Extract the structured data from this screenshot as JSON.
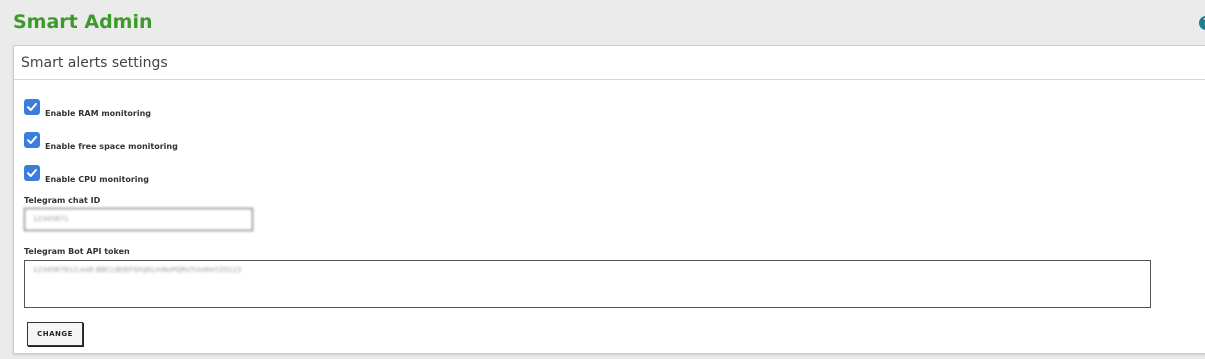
{
  "header": {
    "app_title": "Smart Admin",
    "help_icon": "?"
  },
  "panel": {
    "title": "Smart alerts settings",
    "checkboxes": [
      {
        "label": "Enable RAM monitoring",
        "checked": true
      },
      {
        "label": "Enable free space monitoring",
        "checked": true
      },
      {
        "label": "Enable CPU monitoring",
        "checked": true
      }
    ],
    "chat_id": {
      "label": "Telegram chat ID",
      "value": "12345671"
    },
    "bot_token": {
      "label": "Telegram Bot API token",
      "value": "1234567812:AAE-BBCcdDEFGhiJKLmNoPQRsTUvWxYZ0123"
    },
    "change_button": "CHANGE"
  },
  "colors": {
    "brand": "#3c9a2b",
    "checkbox": "#3b7ddd",
    "background": "#ebebeb"
  }
}
